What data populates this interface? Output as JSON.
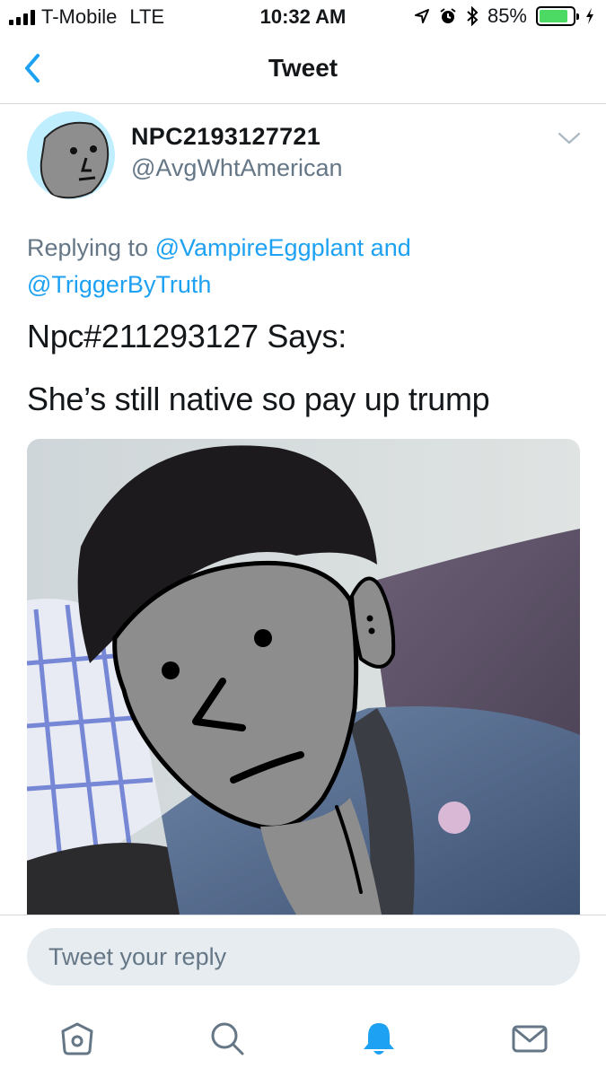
{
  "status_bar": {
    "carrier": "T-Mobile",
    "network": "LTE",
    "time": "10:32 AM",
    "battery": "85%",
    "battery_level": 0.85
  },
  "nav": {
    "title": "Tweet"
  },
  "tweet": {
    "display_name": "NPC2193127721",
    "handle": "@AvgWhtAmerican",
    "replying_prefix": "Replying to",
    "mention_1": "@VampireEggplant",
    "conjunction": "and",
    "mention_2": "@TriggerByTruth",
    "text_line_1": "Npc#211293127 Says:",
    "text_line_2": "She’s still native so pay up trump"
  },
  "reply": {
    "placeholder": "Tweet your reply"
  },
  "tab_bar": {
    "items": [
      "home-icon",
      "search-icon",
      "notifications-icon",
      "messages-icon"
    ],
    "active": "notifications-icon"
  },
  "colors": {
    "accent": "#1da1f2",
    "secondary_text": "#657786",
    "divider": "#d6dadd",
    "reply_background": "#e6ecf0",
    "battery_green": "#4cd964"
  }
}
